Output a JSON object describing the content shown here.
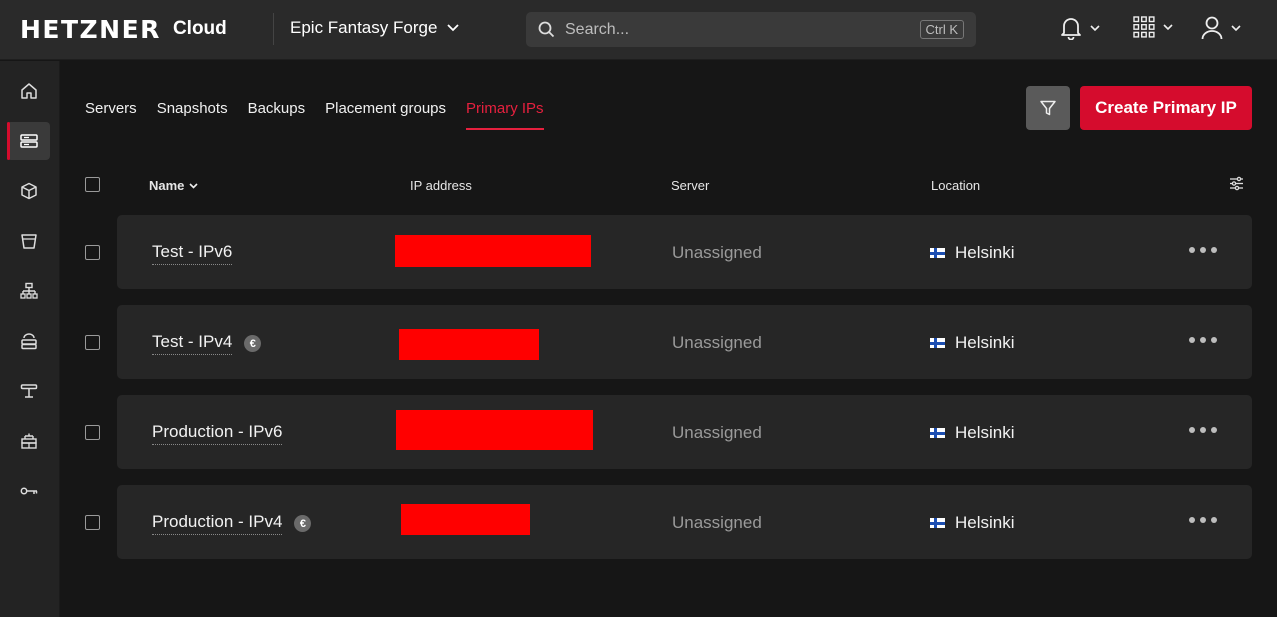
{
  "brand": {
    "logo": "HETZNER",
    "product": "Cloud"
  },
  "project": {
    "name": "Epic Fantasy Forge"
  },
  "search": {
    "placeholder": "Search...",
    "shortcut": "Ctrl K"
  },
  "topbar_icons": [
    "bell-icon",
    "apps-grid-icon",
    "user-icon"
  ],
  "sidebar": {
    "items": [
      {
        "icon": "home-icon"
      },
      {
        "icon": "servers-icon",
        "active": true
      },
      {
        "icon": "volumes-box-icon"
      },
      {
        "icon": "storage-bucket-icon"
      },
      {
        "icon": "load-balancer-icon"
      },
      {
        "icon": "firewall-icon"
      },
      {
        "icon": "networks-icon"
      },
      {
        "icon": "security-icon"
      },
      {
        "icon": "key-icon"
      }
    ]
  },
  "tabs": [
    {
      "label": "Servers"
    },
    {
      "label": "Snapshots"
    },
    {
      "label": "Backups"
    },
    {
      "label": "Placement groups"
    },
    {
      "label": "Primary IPs",
      "active": true
    }
  ],
  "actions": {
    "create_label": "Create Primary IP"
  },
  "table": {
    "headers": {
      "name": "Name",
      "ip": "IP address",
      "server": "Server",
      "location": "Location"
    },
    "rows": [
      {
        "name": "Test - IPv6",
        "billed": false,
        "server": "Unassigned",
        "location": "Helsinki"
      },
      {
        "name": "Test - IPv4",
        "billed": true,
        "badge": "€",
        "server": "Unassigned",
        "location": "Helsinki"
      },
      {
        "name": "Production - IPv6",
        "billed": false,
        "server": "Unassigned",
        "location": "Helsinki"
      },
      {
        "name": "Production - IPv4",
        "billed": true,
        "badge": "€",
        "server": "Unassigned",
        "location": "Helsinki"
      }
    ]
  },
  "colors": {
    "accent": "#d50c2d",
    "redaction": "#ff0000",
    "bg": "#161616",
    "row_bg": "#262626"
  }
}
